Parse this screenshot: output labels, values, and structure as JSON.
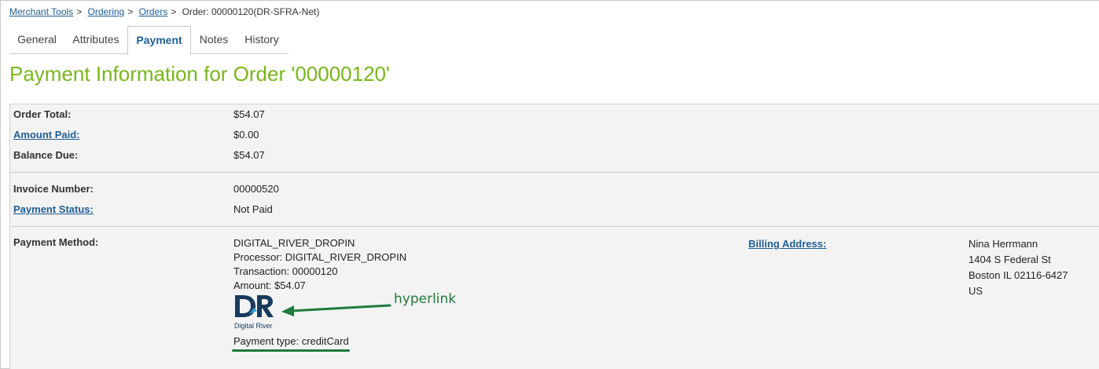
{
  "breadcrumb": {
    "items": [
      "Merchant Tools",
      "Ordering",
      "Orders"
    ],
    "separator": ">",
    "current": "Order: 00000120(DR-SFRA-Net)"
  },
  "tabs": [
    {
      "label": "General",
      "active": false
    },
    {
      "label": "Attributes",
      "active": false
    },
    {
      "label": "Payment",
      "active": true
    },
    {
      "label": "Notes",
      "active": false
    },
    {
      "label": "History",
      "active": false
    }
  ],
  "title": "Payment Information for Order '00000120'",
  "summary": {
    "order_total_label": "Order Total:",
    "order_total_value": "$54.07",
    "amount_paid_label": "Amount Paid:",
    "amount_paid_value": "$0.00",
    "balance_due_label": "Balance Due:",
    "balance_due_value": "$54.07"
  },
  "invoice": {
    "invoice_number_label": "Invoice Number:",
    "invoice_number_value": "00000520",
    "payment_status_label": "Payment Status:",
    "payment_status_value": "Not Paid"
  },
  "payment_method": {
    "label": "Payment Method:",
    "name": "DIGITAL_RIVER_DROPIN",
    "processor": "Processor: DIGITAL_RIVER_DROPIN",
    "transaction": "Transaction: 00000120",
    "amount": "Amount: $54.07",
    "logo_text": "Digital River",
    "logo_icon": "digital-river-logo",
    "payment_type": "Payment type: creditCard"
  },
  "billing": {
    "label": "Billing Address:",
    "name": "Nina Herrmann",
    "street": "1404 S Federal St",
    "city_line": "Boston IL 02116-6427",
    "country": "US"
  },
  "annotation": {
    "text": "hyperlink",
    "color": "#1f7a3e"
  },
  "colors": {
    "link": "#1f5d93",
    "title": "#7ab51d",
    "panel_bg": "#f3f3f3",
    "logo_blue": "#1a3b5c",
    "logo_accent": "#2aa3d8"
  }
}
